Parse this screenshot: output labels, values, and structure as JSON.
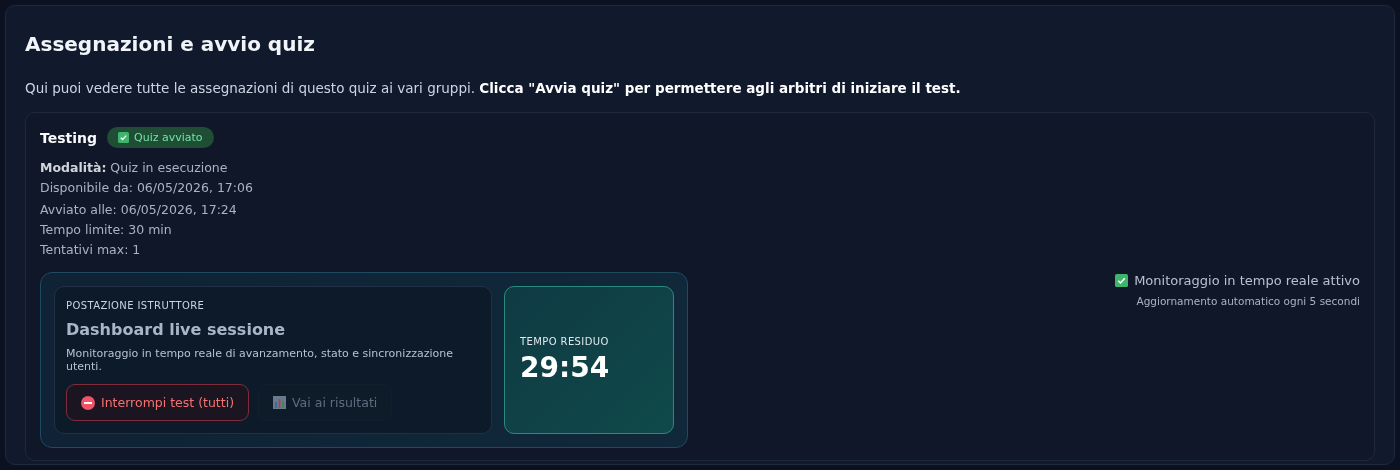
{
  "title": "Assegnazioni e avvio quiz",
  "intro": "Qui puoi vedere tutte le assegnazioni di questo quiz ai vari gruppi.  **Clicca \"Avvia quiz\" per permettere agli arbitri di iniziare il test.**",
  "assignment": {
    "group": "Testing",
    "badge": {
      "label": "Quiz avviato",
      "checked": true
    },
    "details": [
      "**Modalità:** Quiz in esecuzione",
      "Disponibile da: 06/05/2026, 17:06"
    ],
    "run_details": [
      "Avviato alle: 06/05/2026, 17:24",
      "Tempo limite: 30 min",
      "Tentativi max: 1"
    ],
    "monitor": {
      "label": "Monitoraggio in tempo reale attivo",
      "checked": true,
      "note": "Aggiornamento automatico ogni 5 secondi"
    },
    "dashboard": {
      "eyebrow": "POSTAZIONE ISTRUTTORE",
      "heading": "Dashboard live sessione",
      "description": "Monitoraggio in tempo reale di avanzamento, stato e sincronizzazione utenti.",
      "buttons": [
        {
          "kind": "danger",
          "label": "Interrompi test (tutti)",
          "disabled": false
        },
        {
          "kind": "results",
          "label": "Vai ai risultati",
          "disabled": true
        }
      ],
      "timer": {
        "label": "TEMPO RESIDUO",
        "value": "29:54"
      }
    }
  }
}
